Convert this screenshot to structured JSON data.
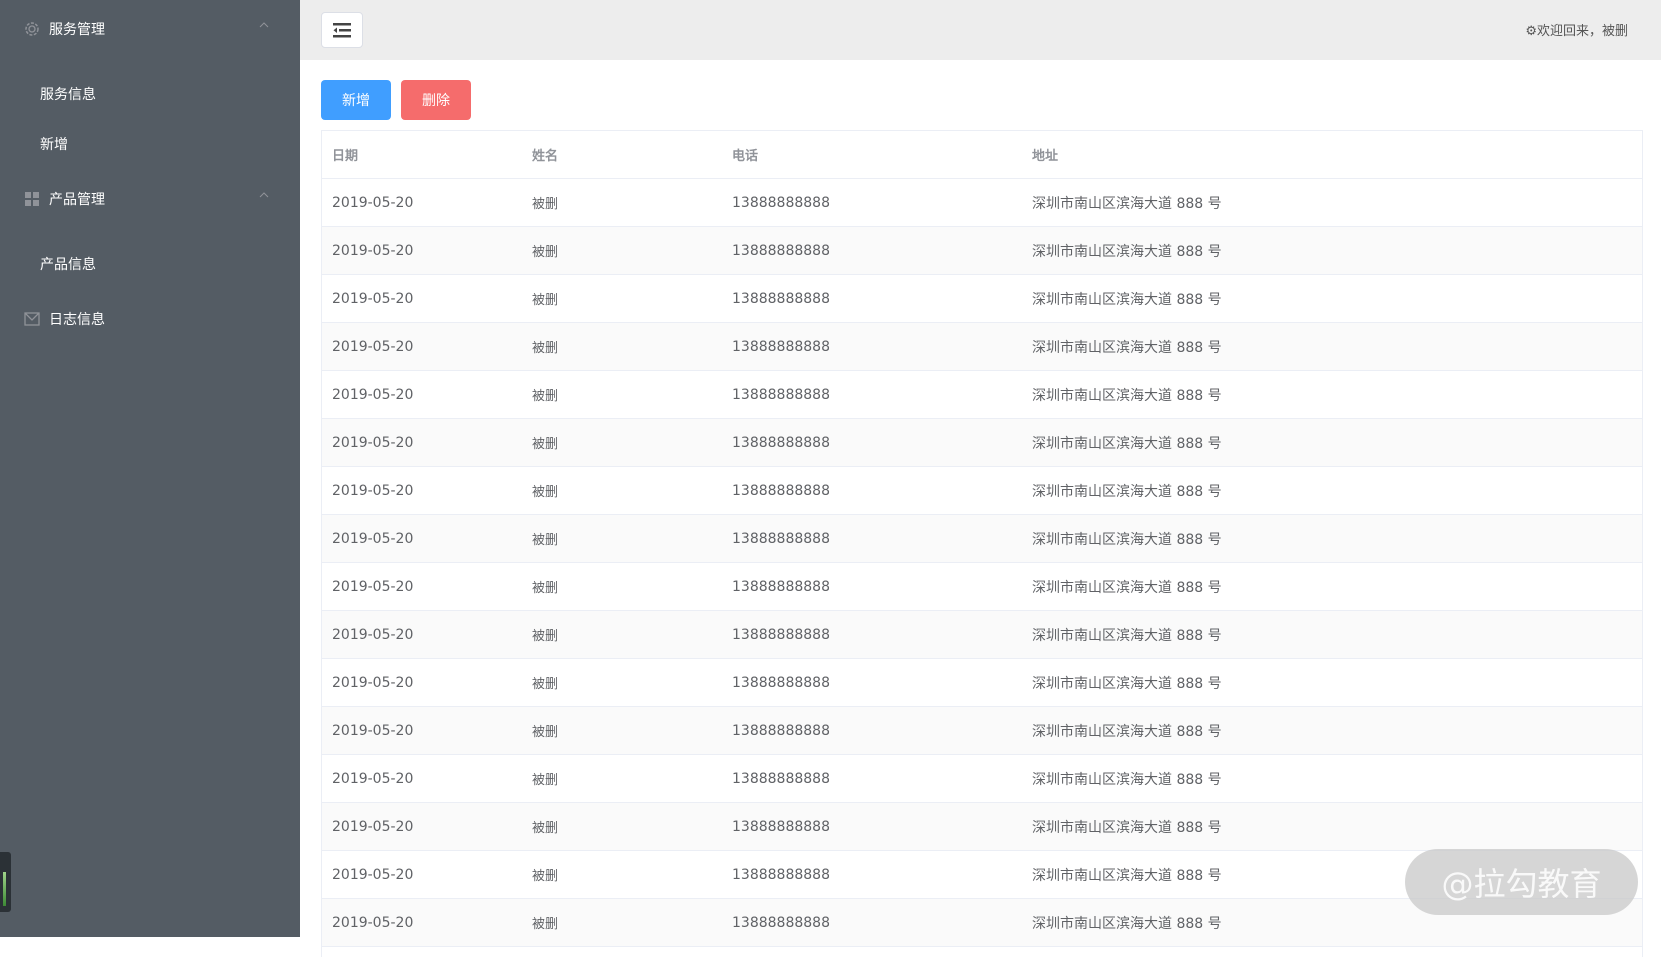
{
  "sidebar": {
    "groups": [
      {
        "label": "服务管理",
        "items": [
          "服务信息",
          "新增"
        ]
      },
      {
        "label": "产品管理",
        "items": [
          "产品信息"
        ]
      },
      {
        "label": "日志信息"
      }
    ]
  },
  "header": {
    "welcome": "欢迎回来，被删"
  },
  "toolbar": {
    "add_label": "新增",
    "delete_label": "删除"
  },
  "table": {
    "columns": [
      "日期",
      "姓名",
      "电话",
      "地址"
    ],
    "rows": [
      [
        "2019-05-20",
        "被删",
        "13888888888",
        "深圳市南山区滨海大道 888 号"
      ],
      [
        "2019-05-20",
        "被删",
        "13888888888",
        "深圳市南山区滨海大道 888 号"
      ],
      [
        "2019-05-20",
        "被删",
        "13888888888",
        "深圳市南山区滨海大道 888 号"
      ],
      [
        "2019-05-20",
        "被删",
        "13888888888",
        "深圳市南山区滨海大道 888 号"
      ],
      [
        "2019-05-20",
        "被删",
        "13888888888",
        "深圳市南山区滨海大道 888 号"
      ],
      [
        "2019-05-20",
        "被删",
        "13888888888",
        "深圳市南山区滨海大道 888 号"
      ],
      [
        "2019-05-20",
        "被删",
        "13888888888",
        "深圳市南山区滨海大道 888 号"
      ],
      [
        "2019-05-20",
        "被删",
        "13888888888",
        "深圳市南山区滨海大道 888 号"
      ],
      [
        "2019-05-20",
        "被删",
        "13888888888",
        "深圳市南山区滨海大道 888 号"
      ],
      [
        "2019-05-20",
        "被删",
        "13888888888",
        "深圳市南山区滨海大道 888 号"
      ],
      [
        "2019-05-20",
        "被删",
        "13888888888",
        "深圳市南山区滨海大道 888 号"
      ],
      [
        "2019-05-20",
        "被删",
        "13888888888",
        "深圳市南山区滨海大道 888 号"
      ],
      [
        "2019-05-20",
        "被删",
        "13888888888",
        "深圳市南山区滨海大道 888 号"
      ],
      [
        "2019-05-20",
        "被删",
        "13888888888",
        "深圳市南山区滨海大道 888 号"
      ],
      [
        "2019-05-20",
        "被删",
        "13888888888",
        "深圳市南山区滨海大道 888 号"
      ],
      [
        "2019-05-20",
        "被删",
        "13888888888",
        "深圳市南山区滨海大道 888 号"
      ]
    ]
  },
  "watermark": "@拉勾教育",
  "colors": {
    "sidebar": "#545c64",
    "primary": "#409eff",
    "danger": "#f56c6c"
  }
}
